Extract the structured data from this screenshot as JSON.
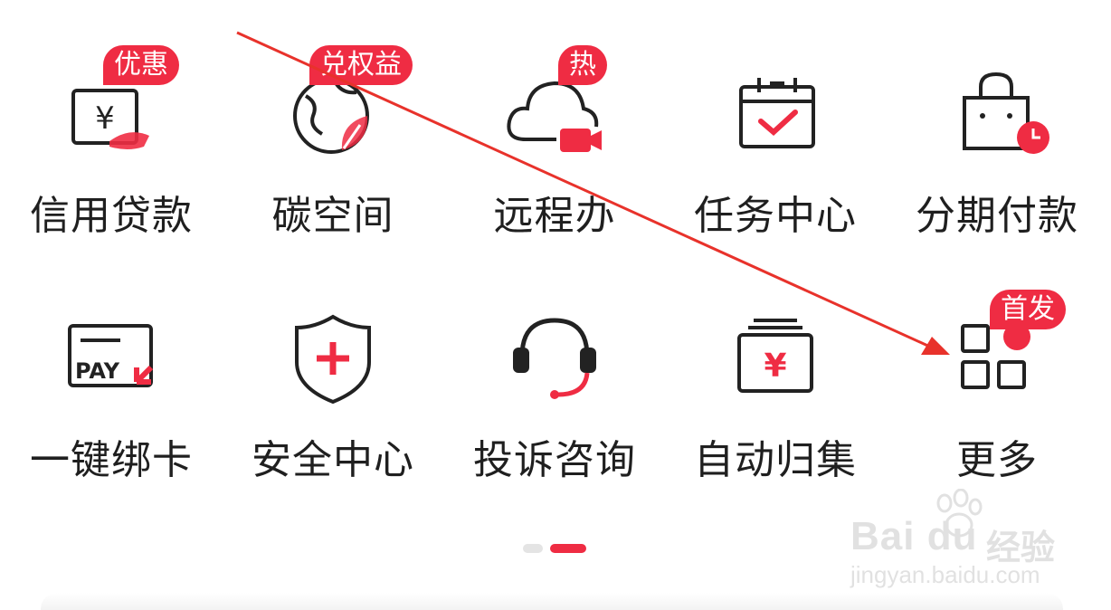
{
  "grid": {
    "row1": [
      {
        "label": "信用贷款",
        "badge": "优惠",
        "icon": "loan-icon"
      },
      {
        "label": "碳空间",
        "badge": "兑权益",
        "icon": "carbon-globe-icon"
      },
      {
        "label": "远程办",
        "badge": "热",
        "icon": "cloud-video-icon"
      },
      {
        "label": "任务中心",
        "badge": "",
        "icon": "calendar-check-icon"
      },
      {
        "label": "分期付款",
        "badge": "",
        "icon": "shopping-bag-clock-icon"
      }
    ],
    "row2": [
      {
        "label": "一键绑卡",
        "badge": "",
        "icon": "pay-card-icon"
      },
      {
        "label": "安全中心",
        "badge": "",
        "icon": "shield-plus-icon"
      },
      {
        "label": "投诉咨询",
        "badge": "",
        "icon": "headset-icon"
      },
      {
        "label": "自动归集",
        "badge": "",
        "icon": "yen-box-icon"
      },
      {
        "label": "更多",
        "badge": "首发",
        "icon": "grid-more-icon"
      }
    ]
  },
  "pager": {
    "pages": 2,
    "active_page": 2
  },
  "watermark": {
    "logo": "Bai du",
    "text": "经验",
    "url": "jingyan.baidu.com"
  },
  "colors": {
    "accent": "#ef2c43",
    "text": "#1f1f1f",
    "icon_stroke": "#222222",
    "arrow": "#e8322b"
  }
}
